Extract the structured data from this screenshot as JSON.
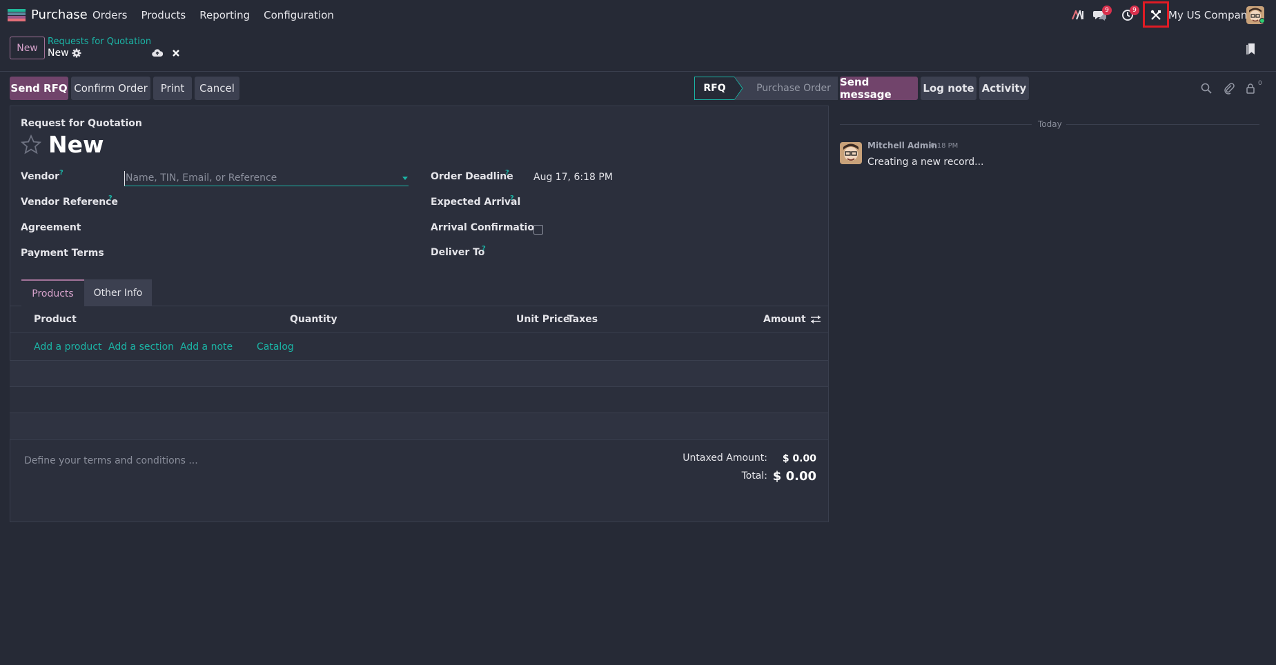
{
  "navbar": {
    "app_name": "Purchase",
    "menu": [
      "Orders",
      "Products",
      "Reporting",
      "Configuration"
    ],
    "discuss_badge": "9",
    "activity_badge": "9",
    "company": "My US Company",
    "icons": [
      "ai-icon",
      "discuss-icon",
      "activity-clock-icon",
      "debug-tools-icon"
    ]
  },
  "control_panel": {
    "new_label": "New",
    "breadcrumb_parent": "Requests for Quotation",
    "breadcrumb_current": "New"
  },
  "actions": {
    "send_rfq": "Send RFQ",
    "confirm_order": "Confirm Order",
    "print": "Print",
    "cancel": "Cancel"
  },
  "statusbar": {
    "stages": [
      "RFQ",
      "Purchase Order"
    ],
    "current": "RFQ"
  },
  "form": {
    "subtitle": "Request for Quotation",
    "title": "New",
    "left_fields": {
      "vendor": "Vendor",
      "vendor_placeholder": "Name, TIN, Email, or Reference",
      "vendor_reference": "Vendor Reference",
      "agreement": "Agreement",
      "payment_terms": "Payment Terms"
    },
    "right_fields": {
      "order_deadline": "Order Deadline",
      "order_deadline_value": "Aug 17, 6:18 PM",
      "expected_arrival": "Expected Arrival",
      "arrival_confirmation": "Arrival Confirmation",
      "deliver_to": "Deliver To"
    },
    "help_mark": "?",
    "tabs": [
      "Products",
      "Other Info"
    ],
    "table": {
      "columns": [
        "Product",
        "Quantity",
        "Unit Price",
        "Taxes",
        "Amount"
      ],
      "add_links": [
        "Add a product",
        "Add a section",
        "Add a note",
        "Catalog"
      ]
    },
    "terms_placeholder": "Define your terms and conditions ...",
    "totals": {
      "untaxed_label": "Untaxed Amount:",
      "untaxed_value": "$ 0.00",
      "total_label": "Total:",
      "total_value": "$ 0.00"
    }
  },
  "chatter": {
    "send_message": "Send message",
    "log_note": "Log note",
    "activity": "Activity",
    "followers_count": "0",
    "date_separator": "Today",
    "messages": [
      {
        "author": "Mitchell Admin",
        "time": "6:18 PM",
        "body": "Creating a new record..."
      }
    ]
  },
  "colors": {
    "background": "#262a36",
    "sheet": "#2b2f3c",
    "primary": "#71446b",
    "accent_teal": "#1bb5a6",
    "badge": "#d9304d"
  }
}
